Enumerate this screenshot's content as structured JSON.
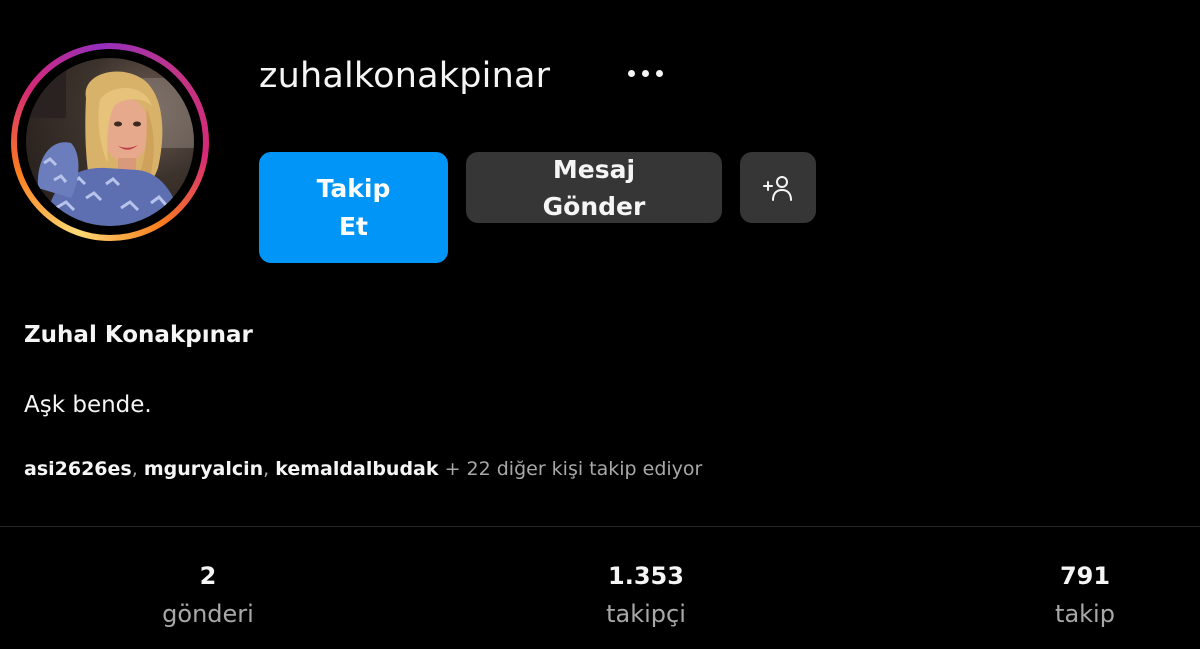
{
  "profile": {
    "username": "zuhalkonakpinar",
    "full_name": "Zuhal Konakpınar",
    "bio": "Aşk bende."
  },
  "actions": {
    "follow_label": "Takip Et",
    "message_label": "Mesaj Gönder",
    "add_user_icon": "person-plus-icon",
    "more_icon": "ellipsis-icon"
  },
  "followed_by": {
    "users": [
      "asi2626es",
      "mguryalcin",
      "kemaldalbudak"
    ],
    "separator": ", ",
    "suffix": "+ 22 diğer kişi takip ediyor"
  },
  "stats": {
    "posts": {
      "value": "2",
      "label": "gönderi"
    },
    "followers": {
      "value": "1.353",
      "label": "takipçi"
    },
    "following": {
      "value": "791",
      "label": "takip"
    }
  },
  "colors": {
    "background": "#000000",
    "primary_button": "#0095f6",
    "secondary_button": "#363636",
    "secondary_text": "#a8a8a8"
  }
}
